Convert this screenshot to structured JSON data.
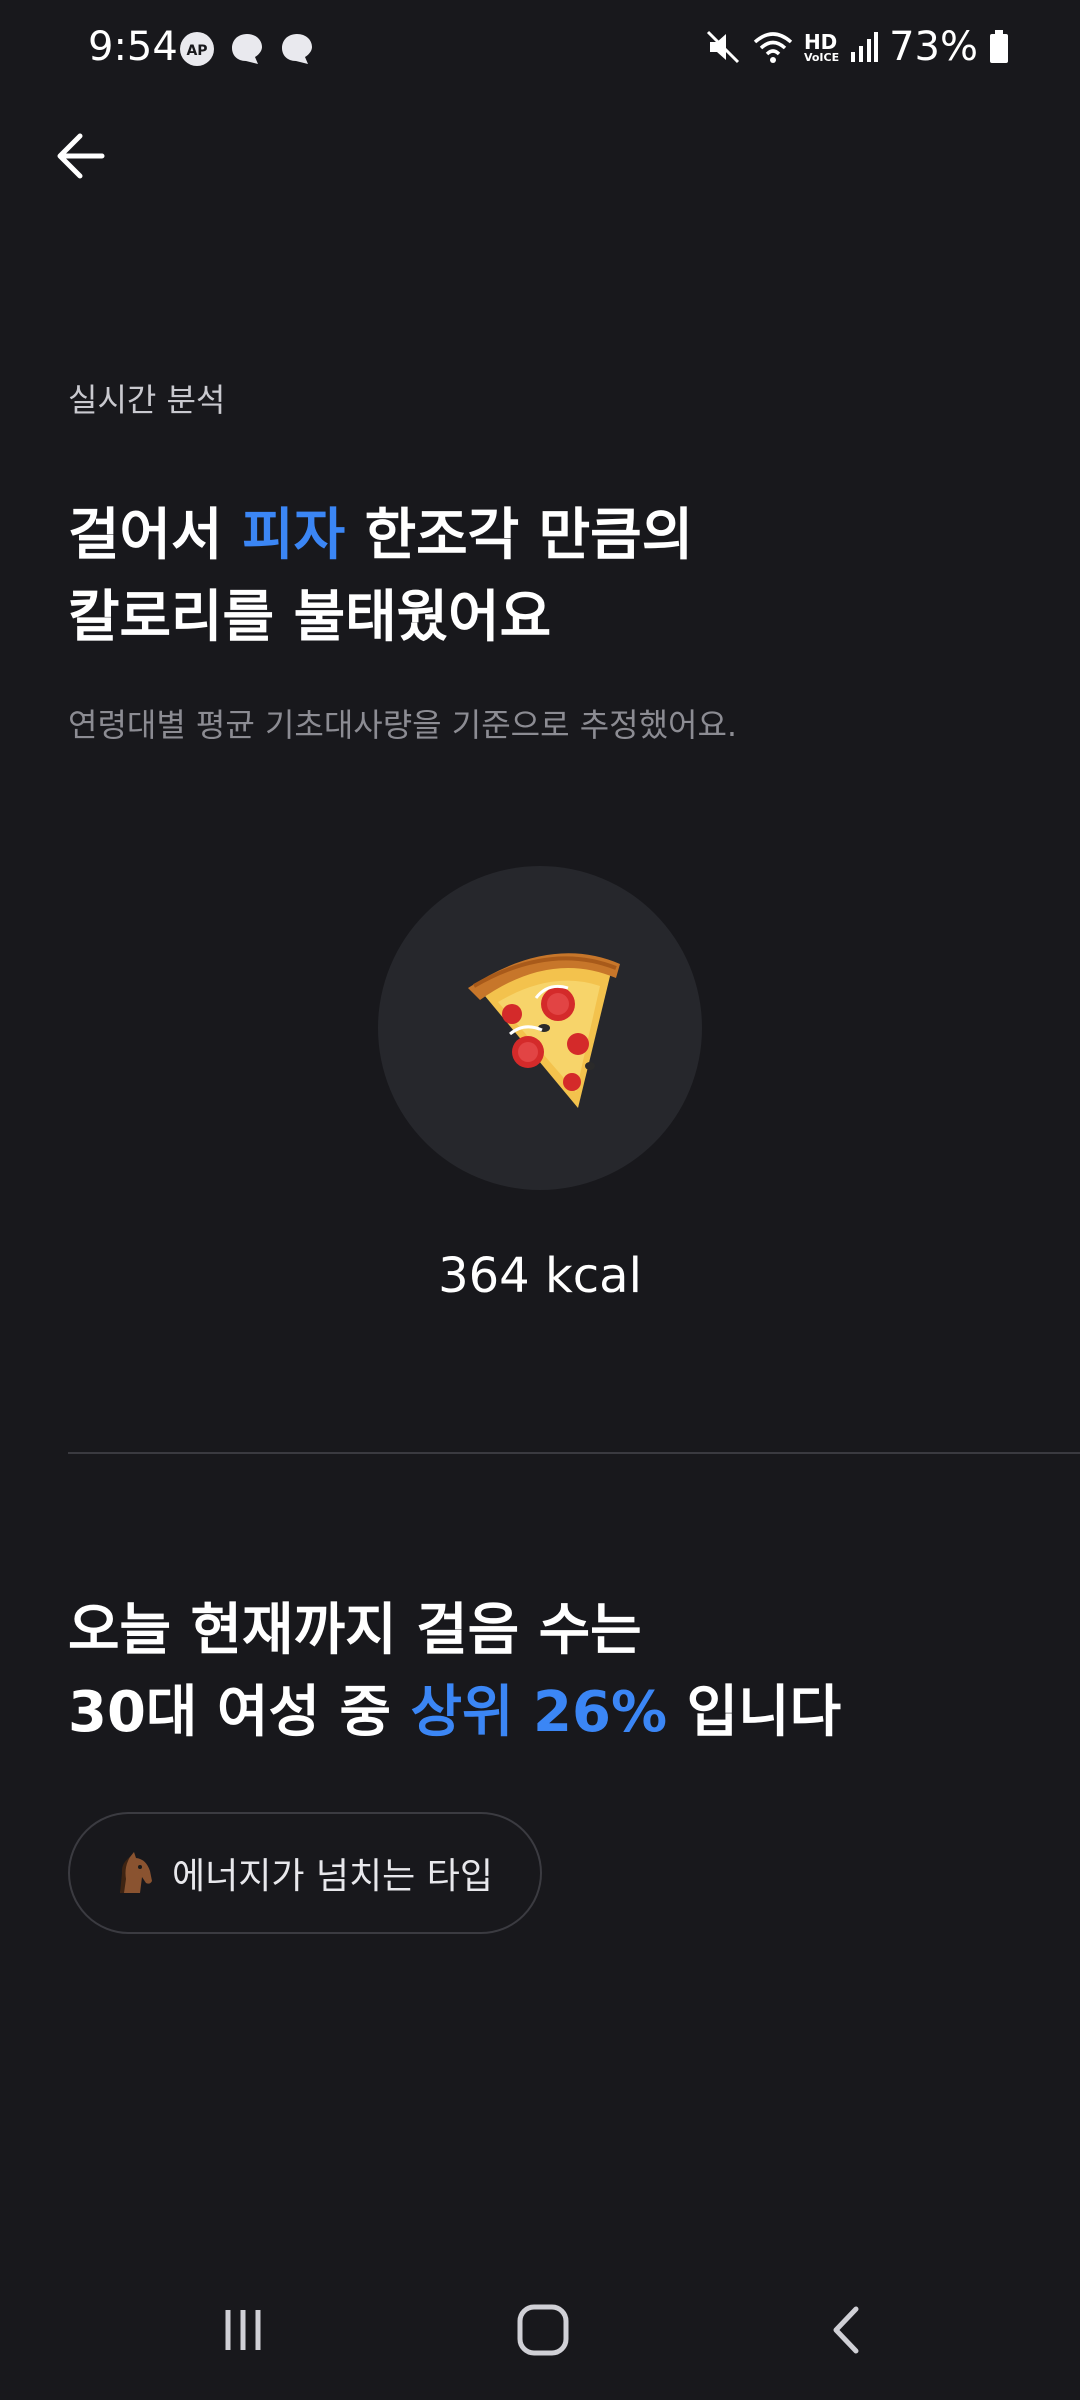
{
  "status": {
    "time": "9:54",
    "battery": "73%",
    "hd_label": "HD",
    "voice_label": "VoICE"
  },
  "header": {
    "section_label": "실시간 분석"
  },
  "calories": {
    "headline_pre": "걸어서 ",
    "headline_food": "피자",
    "headline_post": " 한조각 만큼의",
    "headline_line2": "칼로리를 불태웠어요",
    "subtext": "연령대별 평균 기초대사량을 기준으로 추정했어요.",
    "food_icon": "pizza-slice-icon",
    "kcal": "364 kcal"
  },
  "ranking": {
    "line1": "오늘 현재까지 걸음 수는",
    "line2_pre": "30대 여성 중 ",
    "line2_accent": "상위 26%",
    "line2_post": " 입니다",
    "chip_icon": "horse-icon",
    "chip_label": "에너지가 넘치는 타입"
  },
  "colors": {
    "background": "#18181c",
    "accent": "#3b86f5",
    "circle": "#26272c"
  }
}
